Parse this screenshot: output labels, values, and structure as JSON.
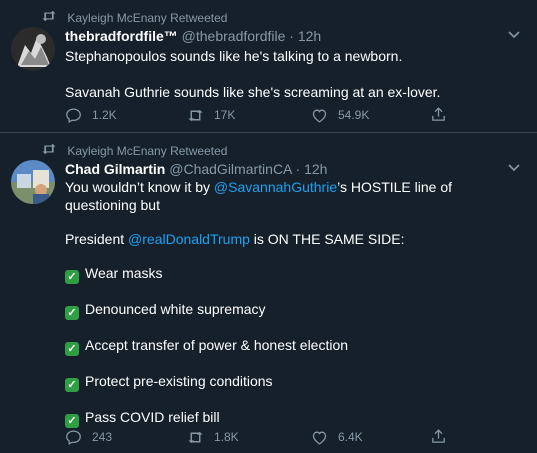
{
  "tweets": [
    {
      "retweet_label": "Kayleigh McEnany Retweeted",
      "name": "thebradfordfile™",
      "handle": "@thebradfordfile",
      "separator": "·",
      "time": "12h",
      "lines": [
        "Stephanopoulos sounds like he's talking to a newborn.",
        "",
        "Savanah Guthrie sounds like she's screaming at an ex-lover."
      ],
      "replies": "1.2K",
      "retweets": "17K",
      "likes": "54.9K"
    },
    {
      "retweet_label": "Kayleigh McEnany Retweeted",
      "name": "Chad Gilmartin",
      "handle": "@ChadGilmartinCA",
      "separator": "·",
      "time": "12h",
      "line1_pre": "You wouldn’t know it by ",
      "line1_mention": "@SavannahGuthrie",
      "line1_post": "’s HOSTILE line of",
      "line2": "questioning but",
      "line3_pre": "President ",
      "line3_mention": "@realDonaldTrump",
      "line3_post": " is ON THE SAME SIDE:",
      "checklist": [
        "Wear masks",
        "Denounced white supremacy",
        "Accept transfer of power & honest election",
        "Protect pre-existing conditions",
        "Pass COVID relief bill"
      ],
      "replies": "243",
      "retweets": "1.8K",
      "likes": "6.4K"
    }
  ],
  "icons": {
    "retweet": "retweet-icon",
    "reply": "reply-icon",
    "like": "heart-icon",
    "share": "share-icon",
    "more": "chevron-down-icon",
    "check": "check-mark-icon"
  },
  "colors": {
    "background": "#15202b",
    "secondary_text": "#8899a6",
    "link": "#1da1f2",
    "divider": "#38444d",
    "check": "#2ea043"
  }
}
